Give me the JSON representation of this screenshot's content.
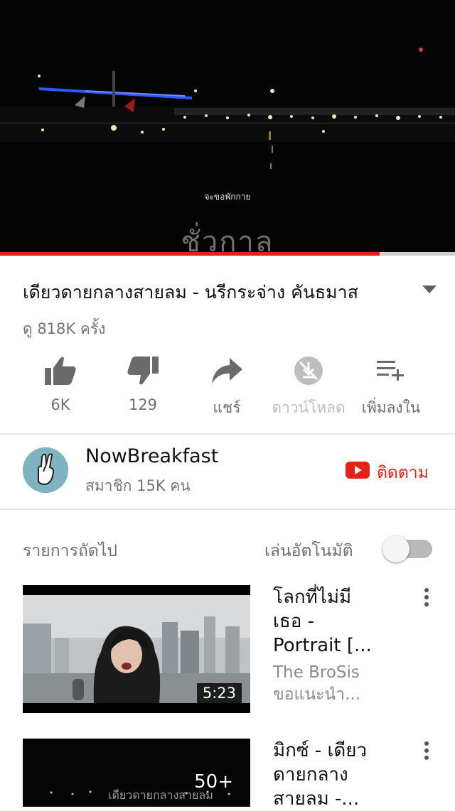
{
  "player": {
    "subtitle_small": "จะขอพักกาย",
    "subtitle_big": "ชั่วกาล",
    "progress": 0.835
  },
  "video": {
    "title": "เดียวดายกลางสายลม - นรีกระจ่าง คันธมาส",
    "views": "ดู 818K ครั้ง"
  },
  "actions": [
    {
      "label": "6K",
      "icon": "thumbs-up-icon"
    },
    {
      "label": "129",
      "icon": "thumbs-down-icon"
    },
    {
      "label": "แชร์",
      "icon": "share-icon"
    },
    {
      "label": "ดาวน์โหลด",
      "icon": "download-disabled-icon"
    },
    {
      "label": "เพิ่มลงใน",
      "icon": "add-to-playlist-icon"
    }
  ],
  "channel": {
    "name": "NowBreakfast",
    "subscribers": "สมาชิก 15K คน",
    "subscribe_label": "ติดตาม",
    "accent": "#e62117"
  },
  "up_next": {
    "label": "รายการถัดไป",
    "autoplay_label": "เล่นอัตโนมัติ",
    "autoplay_on": false
  },
  "items": [
    {
      "title_line1": "โลกที่ไม่มี",
      "title_line2": "เธอ -",
      "title_line3": "Portrait  [...",
      "channel_line1": "The BroSis",
      "channel_line2": "ขอแนะนำ...",
      "duration": "5:23"
    },
    {
      "title_line1": "มิกซ์ - เดียว",
      "title_line2": "ดายกลาง",
      "title_line3": "สายลม -...",
      "playlist_count": "50+",
      "thumb_caption": "เดียวดายกลางสายลม"
    }
  ]
}
